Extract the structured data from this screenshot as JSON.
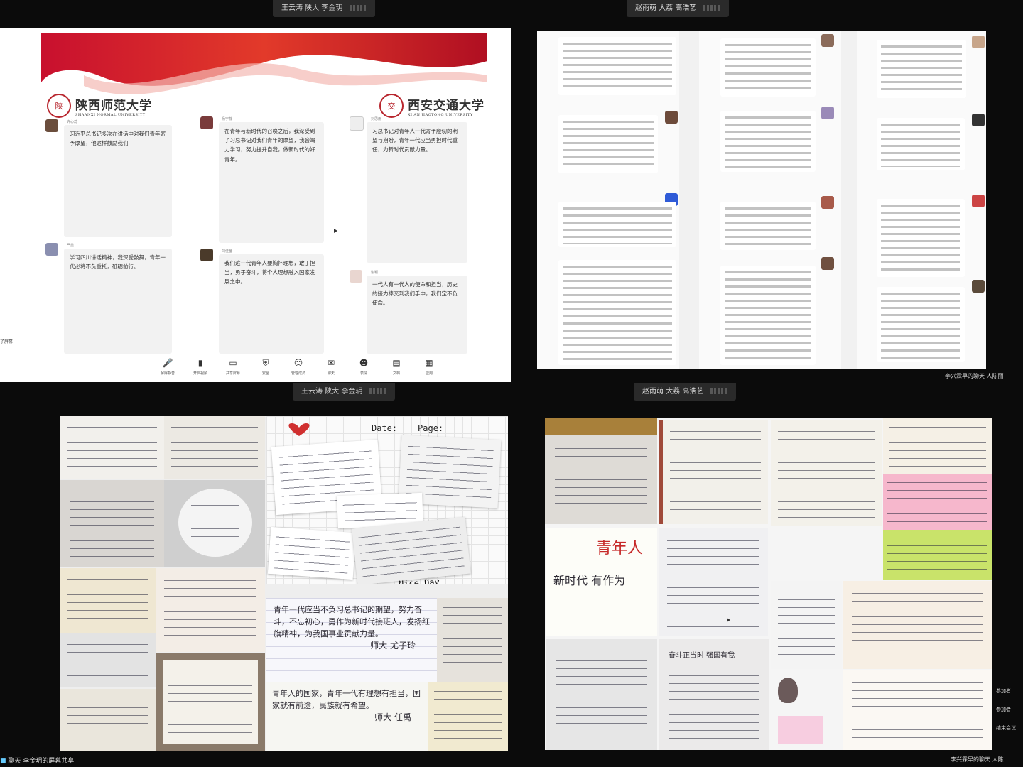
{
  "top_left_namebar": "王云涛 陕大 李金玥",
  "top_right_namebar": "赵雨萌 大荔 高浩艺",
  "bottom_left_namebar": "王云涛 陕大 李金玥",
  "bottom_right_namebar": "赵雨萌 大荔 高浩艺",
  "q1": {
    "logo_left": {
      "name": "陕西师范大学",
      "en": "SHAANXI NORMAL UNIVERSITY",
      "seal": "陕"
    },
    "logo_right": {
      "name": "西安交通大学",
      "en": "XI'AN JIAOTONG UNIVERSITY",
      "seal": "交"
    },
    "left_edge_label": "了屏幕",
    "chats": [
      {
        "user": "许心蕊",
        "text": "习近平总书记多次在讲话中对我们青年寄予厚望，他这样鼓励我们"
      },
      {
        "user": "杨宁静",
        "text": "在青年与新时代的召唤之后，我深受到了习总书记对我们青年的厚望，我会竭力学习，努力提升自我，做新时代的好青年。"
      },
      {
        "user": "刘思雨",
        "text": "习总书记对青年人一代寄予殷切的期望与期盼，青年一代应当勇担时代重任，为新时代贡献力量。"
      },
      {
        "user": "严曼",
        "text": "学习四川讲话精神，我深受鼓舞，青年一代必将不负重托，砥砺前行。"
      },
      {
        "user": "刘佳莹",
        "text": "我们这一代青年人要胸怀理想，敢于担当，勇于奋斗，将个人理想融入国家发展之中。"
      },
      {
        "user": "谢颖",
        "text": "一代人有一代人的使命和担当，历史的接力棒交到我们手中，我们定不负使命。"
      }
    ],
    "toolbar": [
      {
        "label": "解除静音",
        "icon": "mic-off-icon",
        "glyph": "🎤"
      },
      {
        "label": "开启视频",
        "icon": "video-icon",
        "glyph": "▮"
      },
      {
        "label": "共享屏幕",
        "icon": "share-screen-icon",
        "glyph": "▭"
      },
      {
        "label": "安全",
        "icon": "security-icon",
        "glyph": "⛨"
      },
      {
        "label": "管理成员",
        "icon": "members-icon",
        "glyph": "☺"
      },
      {
        "label": "聊天",
        "icon": "chat-icon",
        "glyph": "✉"
      },
      {
        "label": "表情",
        "icon": "emoji-icon",
        "glyph": "☻"
      },
      {
        "label": "文档",
        "icon": "docs-icon",
        "glyph": "▤"
      },
      {
        "label": "应用",
        "icon": "apps-icon",
        "glyph": "▦"
      }
    ]
  },
  "q2": {
    "footer": "李兴霖早的聊天 人陈丽"
  },
  "q3": {
    "date_label": "Date:___ Page:___",
    "nice_day": "Nice Day",
    "note_large_1": "青年一代应当不负习总书记的期望，努力奋斗，不忘初心，勇作为新时代接班人，发扬红旗精神，为我国事业贡献力量。",
    "note_sign_1": "师大 尤子玲",
    "note_large_2": "青年人的国家，青年一代有理想有担当，国家就有前途，民族就有希望。",
    "note_sign_2": "师大 任禹",
    "footer": "聊天 李金玥的屏幕共享"
  },
  "q4": {
    "card_youth": "青年人",
    "card_line": "新时代 有作为",
    "card_title": "奋斗正当时 强国有我",
    "footer": "李兴霖早的聊天 人陈",
    "side_labels": [
      "参加者",
      "参加者",
      "结束会议"
    ]
  }
}
